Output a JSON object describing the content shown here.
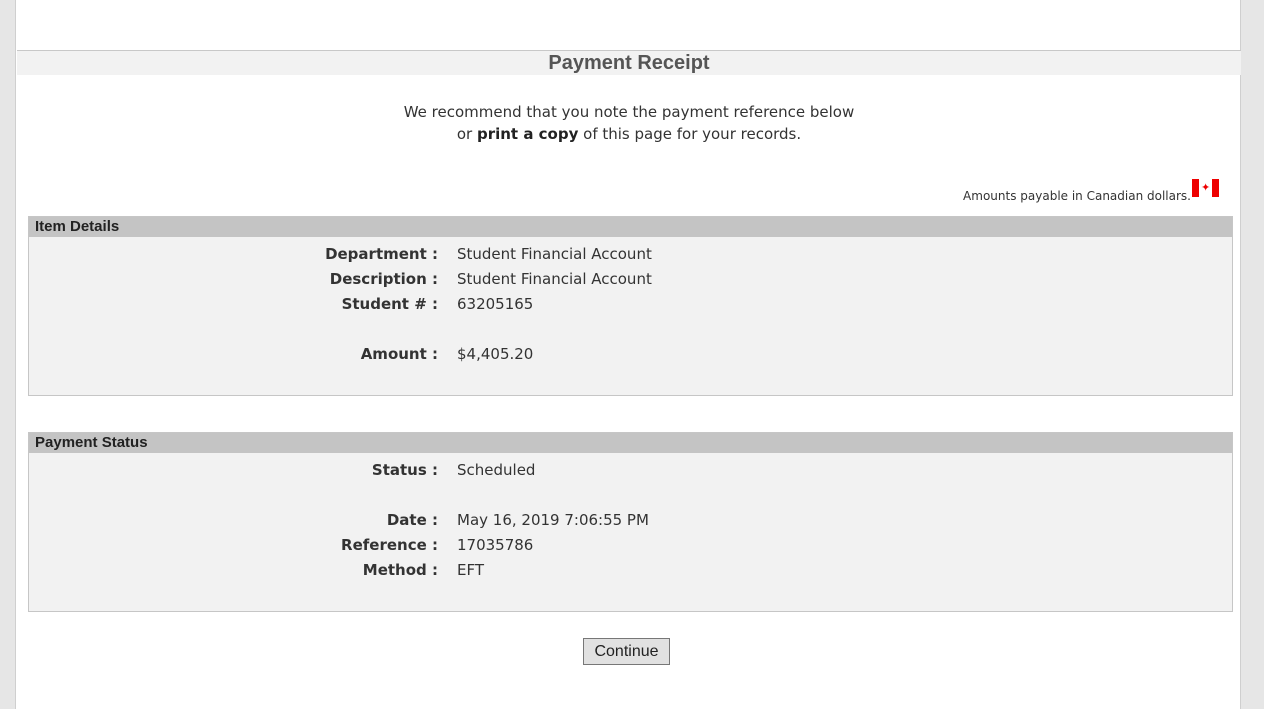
{
  "receipt": {
    "title": "Payment Receipt",
    "intro_line1": "We recommend that you note the payment reference below",
    "intro_line2_pre": "or ",
    "intro_line2_bold": "print a copy",
    "intro_line2_post": " of this page for your records.",
    "currency_note": "Amounts payable in Canadian dollars.",
    "flag_icon": "canada-flag-icon"
  },
  "item_details": {
    "heading": "Item Details",
    "department_label": "Department :",
    "department_value": "Student Financial Account",
    "description_label": "Description :",
    "description_value": "Student Financial Account",
    "student_label": "Student # :",
    "student_value": "63205165",
    "amount_label": "Amount :",
    "amount_value": "$4,405.20"
  },
  "payment_status": {
    "heading": "Payment Status",
    "status_label": "Status :",
    "status_value": "Scheduled",
    "date_label": "Date :",
    "date_value": "May 16, 2019 7:06:55 PM",
    "reference_label": "Reference :",
    "reference_value": "17035786",
    "method_label": "Method :",
    "method_value": "EFT"
  },
  "actions": {
    "continue_label": "Continue"
  },
  "colors": {
    "flag_red": "#ee0000",
    "section_header": "#c4c4c4",
    "section_body": "#f2f2f2"
  }
}
